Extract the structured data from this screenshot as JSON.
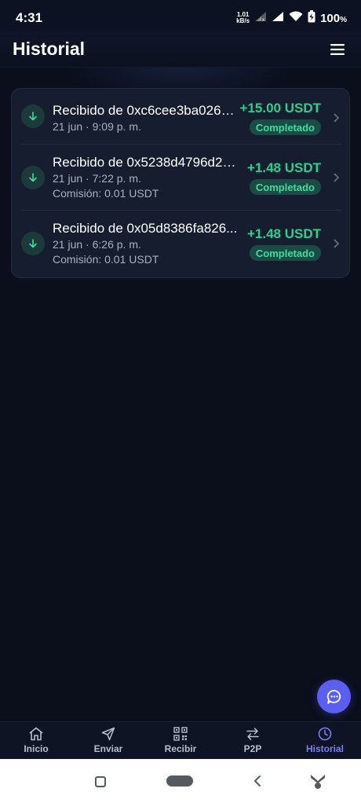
{
  "status_bar": {
    "time": "4:31",
    "net_speed_value": "1.01",
    "net_speed_unit": "kB/s",
    "battery": "100",
    "battery_unit": "%"
  },
  "header": {
    "title": "Historial",
    "menu_icon": "hamburger-menu-icon"
  },
  "transactions": [
    {
      "title": "Recibido de 0xc6cee3ba026e...",
      "date": "21 jun",
      "time": "9:09 p. m.",
      "fee": "",
      "amount": "+15.00 USDT",
      "status": "Completado",
      "icon": "arrow-down-icon"
    },
    {
      "title": "Recibido de 0x5238d4796d20...",
      "date": "21 jun",
      "time": "7:22 p. m.",
      "fee": "Comisión: 0.01 USDT",
      "amount": "+1.48 USDT",
      "status": "Completado",
      "icon": "arrow-down-icon"
    },
    {
      "title": "Recibido de 0x05d8386fa826...",
      "date": "21 jun",
      "time": "6:26 p. m.",
      "fee": "Comisión: 0.01 USDT",
      "amount": "+1.48 USDT",
      "status": "Completado",
      "icon": "arrow-down-icon"
    }
  ],
  "bottom_nav": [
    {
      "label": "Inicio",
      "icon": "home-icon"
    },
    {
      "label": "Enviar",
      "icon": "send-icon"
    },
    {
      "label": "Recibir",
      "icon": "qr-code-icon"
    },
    {
      "label": "P2P",
      "icon": "swap-arrows-icon"
    },
    {
      "label": "Historial",
      "icon": "clock-icon",
      "active": true
    }
  ],
  "colors": {
    "background": "#0b0f1c",
    "card": "#161d2f",
    "positive_amount": "#2ccf8f",
    "badge_bg": "#1c4a44",
    "accent": "#7c7ff5",
    "fab": "#5b5ff0"
  }
}
